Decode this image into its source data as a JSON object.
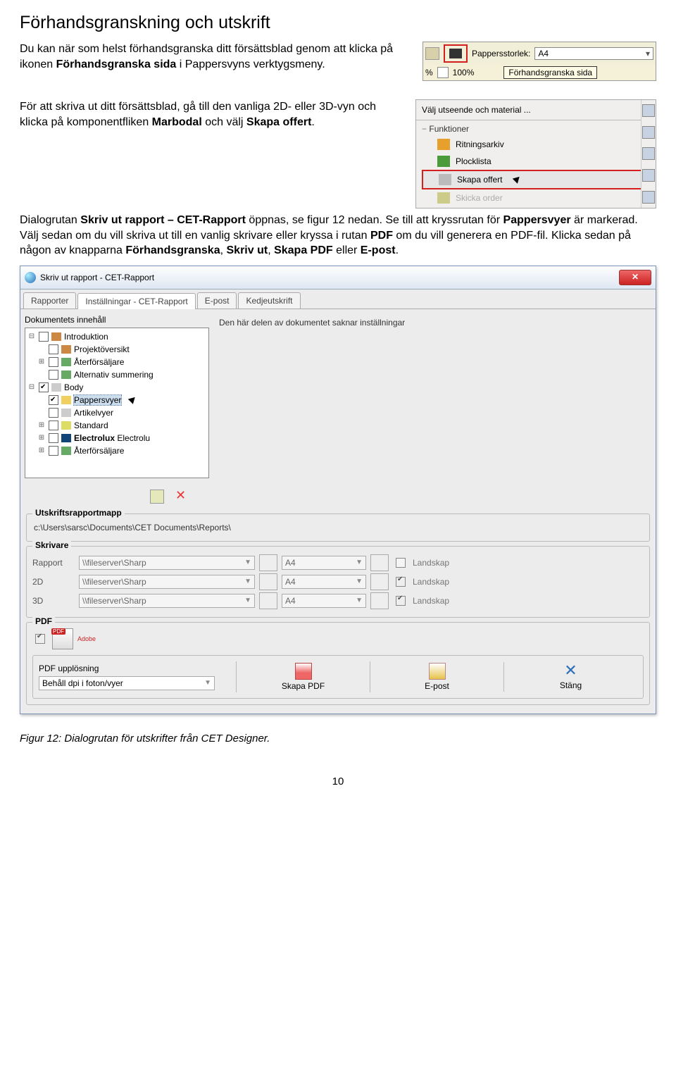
{
  "heading": "Förhandsgranskning och utskrift",
  "para1_a": "Du kan när som helst förhandsgranska ditt försättsblad genom att klicka på ikonen ",
  "para1_b": "Förhandsgranska sida",
  "para1_c": " i Pappersvyns verktygsmeny.",
  "para2_a": "För att skriva ut ditt försättsblad, gå till den vanliga 2D- eller 3D-vyn och klicka på komponentfliken ",
  "para2_b": "Marbodal",
  "para2_c": " och välj ",
  "para2_d": "Skapa offert",
  "para2_e": ".",
  "para3_a": "Dialogrutan ",
  "para3_b": "Skriv ut rapport – CET-Rapport",
  "para3_c": " öppnas, se figur 12 nedan. Se till att kryssrutan för ",
  "para3_d": "Pappersvyer",
  "para3_e": " är markerad. Välj sedan om du vill skriva ut till en vanlig skrivare eller kryssa i rutan ",
  "para3_f": "PDF",
  "para3_g": " om du vill generera en PDF-fil. Klicka sedan på någon av knapparna ",
  "para3_h": "Förhandsgranska",
  "para3_i": ", ",
  "para3_j": "Skriv ut",
  "para3_k": ", ",
  "para3_l": "Skapa PDF",
  "para3_m": " eller ",
  "para3_n": "E-post",
  "para3_o": ".",
  "toolbar": {
    "label": "Pappersstorlek:",
    "value": "A4",
    "pct": "%",
    "zoom": "100%",
    "tooltip": "Förhandsgranska sida"
  },
  "panel": {
    "header": "Välj utseende och material ...",
    "sub": "Funktioner",
    "items": [
      "Ritningsarkiv",
      "Plocklista",
      "Skapa offert",
      "Skicka order"
    ]
  },
  "dialog": {
    "title": "Skriv ut rapport - CET-Rapport",
    "tabs": [
      "Rapporter",
      "Inställningar - CET-Rapport",
      "E-post",
      "Kedjeutskrift"
    ],
    "treeHeader": "Dokumentets innehåll",
    "msg": "Den här delen av dokumentet saknar inställningar",
    "tree": {
      "n0": "Introduktion",
      "n1": "Projektöversikt",
      "n2": "Återförsäljare",
      "n3": "Alternativ summering",
      "n4": "Body",
      "n5": "Pappersvyer",
      "n6": "Artikelvyer",
      "n7": "Standard",
      "n8a": "Electrolux",
      "n8b": "Electrolu",
      "n9": "Återförsäljare"
    },
    "grp_folder": "Utskriftsrapportmapp",
    "path": "c:\\Users\\sarsc\\Documents\\CET Documents\\Reports\\",
    "grp_prn": "Skrivare",
    "prn": {
      "r1": "Rapport",
      "r2": "2D",
      "r3": "3D",
      "printer": "\\\\fileserver\\Sharp",
      "paper": "A4",
      "land": "Landskap"
    },
    "grp_pdf": "PDF",
    "pdf_adobe": "Adobe",
    "pdf_res_label": "PDF upplösning",
    "pdf_res": "Behåll dpi i foton/vyer",
    "btn_pdf": "Skapa PDF",
    "btn_mail": "E-post",
    "btn_close": "Stäng"
  },
  "figcaption": "Figur 12: Dialogrutan för utskrifter från CET Designer.",
  "pagenum": "10"
}
